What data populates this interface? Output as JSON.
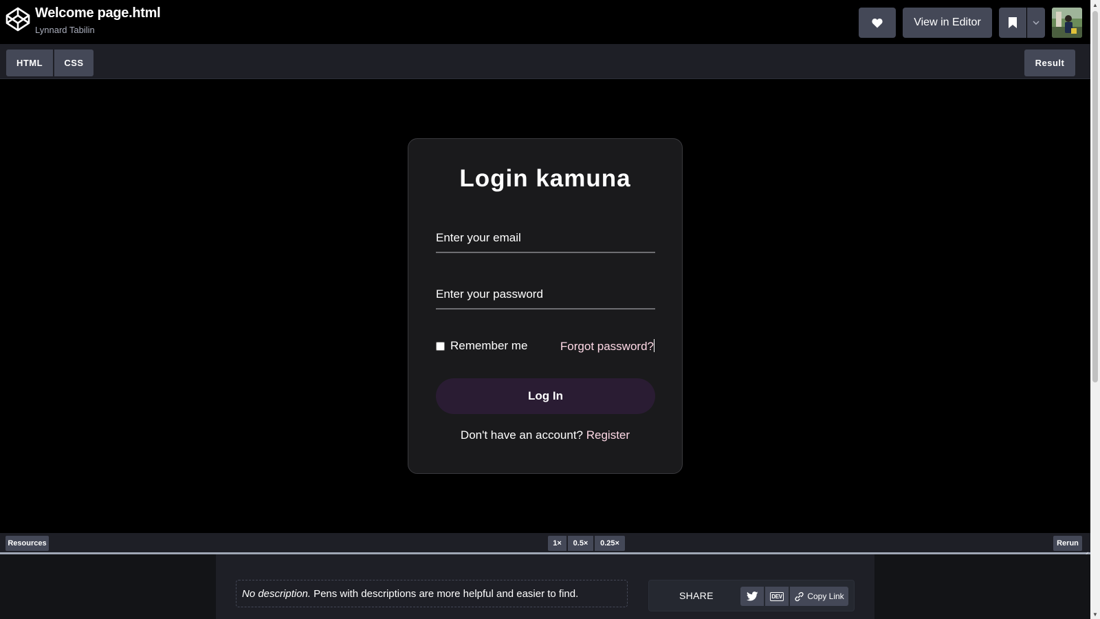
{
  "header": {
    "title": "Welcome page.html",
    "author": "Lynnard Tabilin",
    "view_in_editor_label": "View in Editor",
    "icons": [
      "codepen-logo-icon",
      "heart-icon",
      "bookmark-icon",
      "chevron-down-icon"
    ]
  },
  "tabs": {
    "html": "HTML",
    "css": "CSS",
    "result": "Result"
  },
  "login": {
    "title": "Login kamuna",
    "email_placeholder": "Enter your email",
    "password_placeholder": "Enter your password",
    "remember_label": "Remember me",
    "remember_checked": false,
    "forgot_label": "Forgot password?",
    "login_button": "Log In",
    "register_prompt": "Don't have an account?",
    "register_link": "Register",
    "colors": {
      "card_bg": "#1a1a1c",
      "button_bg": "#2a1c33",
      "link": "#ffd9e6"
    }
  },
  "toolbar": {
    "resources": "Resources",
    "zoom_1x": "1×",
    "zoom_05x": "0.5×",
    "zoom_025x": "0.25×",
    "rerun": "Rerun"
  },
  "footer": {
    "desc_em": "No description.",
    "desc_text": "Pens with descriptions are more helpful and easier to find.",
    "share_label": "SHARE",
    "dev_label": "DEV",
    "copy_link": "Copy Link"
  }
}
